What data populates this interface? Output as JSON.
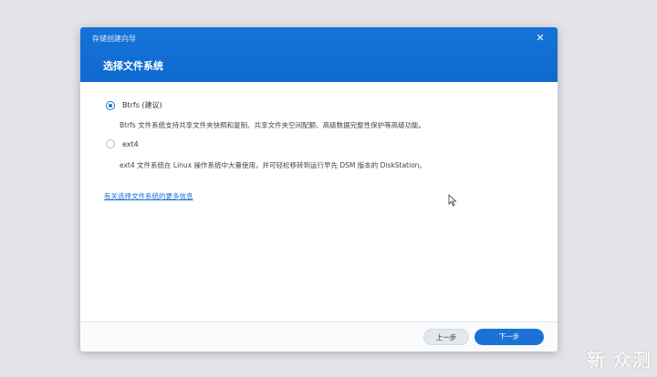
{
  "dialog": {
    "window_title": "存储创建向导",
    "step_title": "选择文件系统",
    "close_icon": "close-icon"
  },
  "options": [
    {
      "label": "Btrfs (建议)",
      "checked": true,
      "description": "Btrfs 文件系统支持共享文件夹快照和复制、共享文件夹空间配额、高级数据完整性保护等高级功能。"
    },
    {
      "label": "ext4",
      "checked": false,
      "description": "ext4 文件系统在 Linux 操作系统中大量使用，并可轻松移转到运行早先 DSM 版本的 DiskStation。"
    }
  ],
  "more_info_link": "有关选择文件系统的更多信息",
  "footer": {
    "prev_label": "上一步",
    "next_label": "下一步"
  },
  "watermark": "新 众测",
  "colors": {
    "header_blue": "#1673d6",
    "accent": "#1a73d4"
  }
}
